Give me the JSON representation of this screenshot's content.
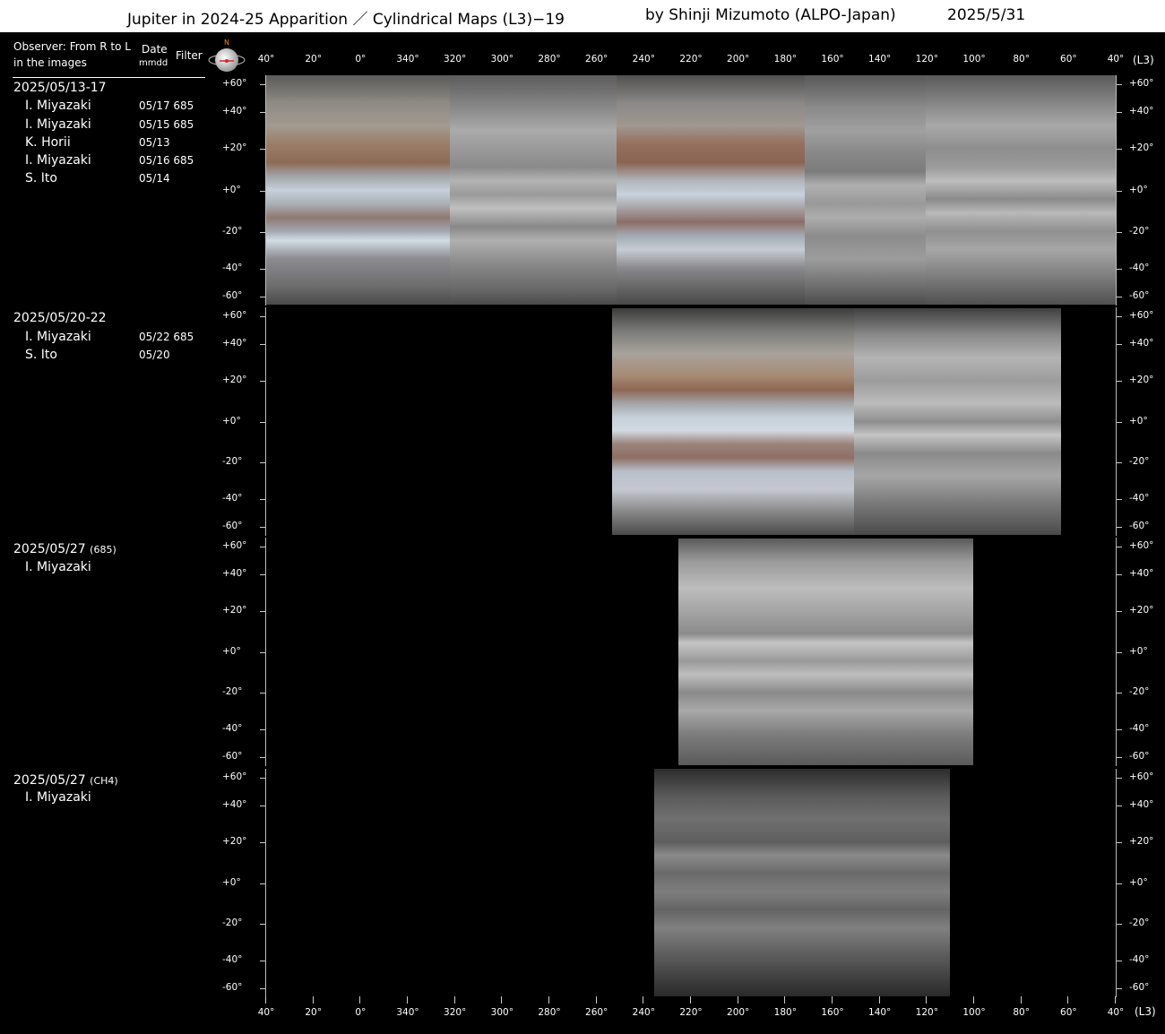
{
  "title": {
    "main": "Jupiter in 2024-25 Apparition ／ Cylindrical Maps (L3)−19",
    "author": "by Shinji Mizumoto (ALPO-Japan)",
    "date": "2025/5/31"
  },
  "header": {
    "observer_line1": "Observer: From R to L",
    "observer_line2": "in the images",
    "date_line1": "Date",
    "date_line2": "mmdd",
    "filter": "Filter",
    "north": "N"
  },
  "longitude_labels": [
    "40°",
    "20°",
    "0°",
    "340°",
    "320°",
    "300°",
    "280°",
    "260°",
    "240°",
    "220°",
    "200°",
    "180°",
    "160°",
    "140°",
    "120°",
    "100°",
    "80°",
    "60°",
    "40°"
  ],
  "system_label": "(L3)",
  "latitude_labels": [
    "+60°",
    "+40°",
    "+20°",
    "+0°",
    "-20°",
    "-40°",
    "-60°"
  ],
  "groups": [
    {
      "title": "2025/05/13-17",
      "observers": [
        {
          "name": "I. Miyazaki",
          "date": "05/17 685"
        },
        {
          "name": "I. Miyazaki",
          "date": "05/15 685"
        },
        {
          "name": "K. Horii",
          "date": "05/13"
        },
        {
          "name": "I. Miyazaki",
          "date": "05/16 685"
        },
        {
          "name": "S. Ito",
          "date": "05/14"
        }
      ]
    },
    {
      "title": "2025/05/20-22",
      "observers": [
        {
          "name": "I. Miyazaki",
          "date": "05/22 685"
        },
        {
          "name": "S. Ito",
          "date": "05/20"
        }
      ]
    },
    {
      "title": "2025/05/27",
      "suffix": "(685)",
      "observers": [
        {
          "name": "I. Miyazaki",
          "date": ""
        }
      ]
    },
    {
      "title": "2025/05/27",
      "suffix": "(CH4)",
      "observers": [
        {
          "name": "I. Miyazaki",
          "date": ""
        }
      ]
    }
  ],
  "colors": {
    "background": "#000000",
    "title_bar": "#ffffff",
    "north_marker": "#ff8800"
  }
}
